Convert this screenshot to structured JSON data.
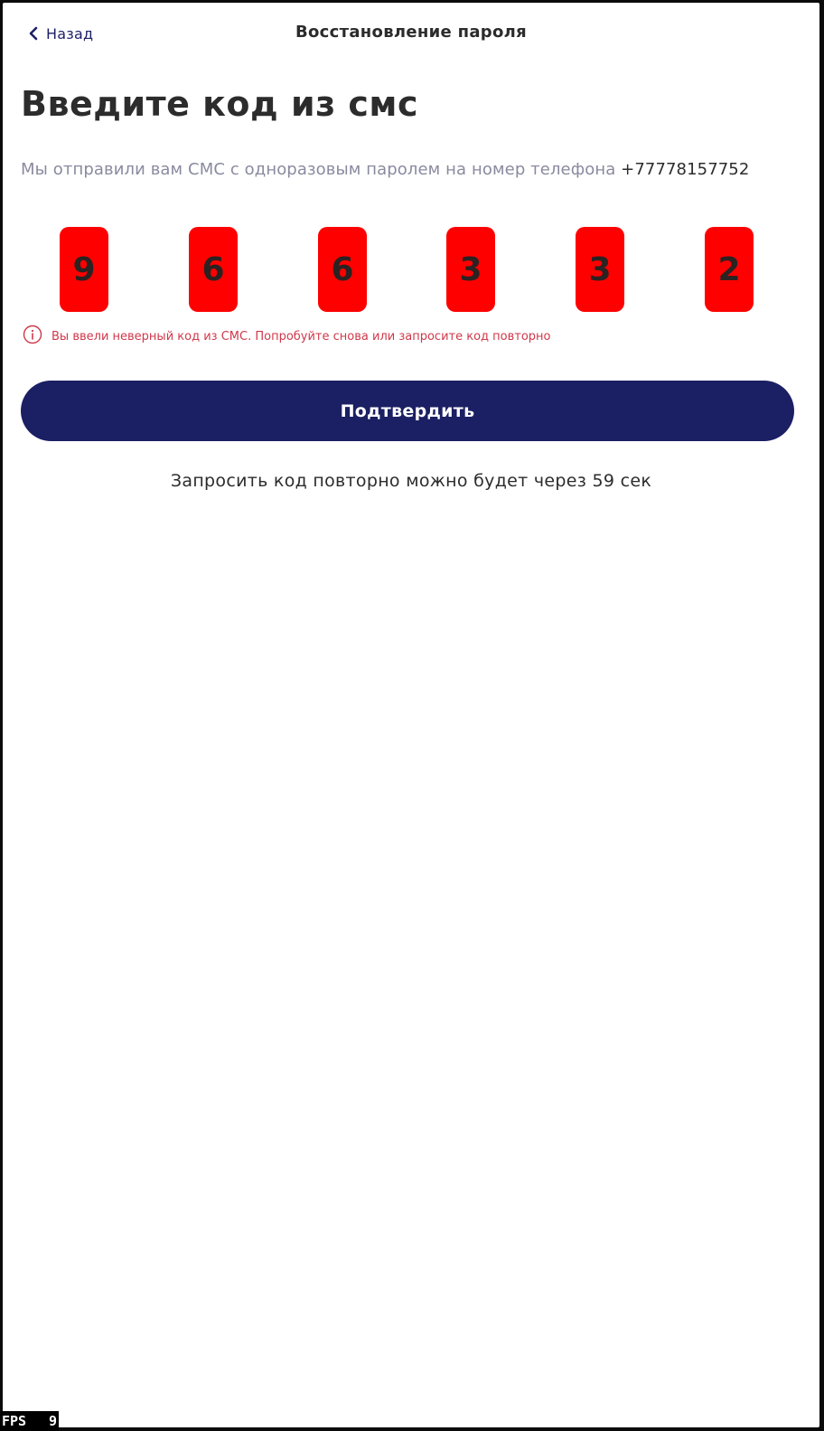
{
  "header": {
    "back_label": "Назад",
    "back_icon": "chevron-left-icon",
    "title": "Восстановление пароля"
  },
  "main": {
    "title": "Введите код из смс",
    "subtitle_text": "Мы отправили вам СМС с одноразовым паролем на номер телефона",
    "phone": "+77778157752",
    "code_digits": [
      "9",
      "6",
      "6",
      "3",
      "3",
      "2"
    ],
    "error_icon": "info-circle-icon",
    "error_message": "Вы ввели неверный код из СМС. Попробуйте снова или запросите код повторно",
    "confirm_label": "Подтвердить",
    "resend_text": "Запросить код повторно можно будет через 59 сек"
  },
  "overlay": {
    "fps_label": "FPS",
    "fps_value": "9"
  },
  "colors": {
    "accent": "#1b1f63",
    "error": "#d0384a",
    "code_cell_bg": "#ff0000",
    "text_primary": "#2c2c2c",
    "text_secondary": "#8a8aa0"
  }
}
